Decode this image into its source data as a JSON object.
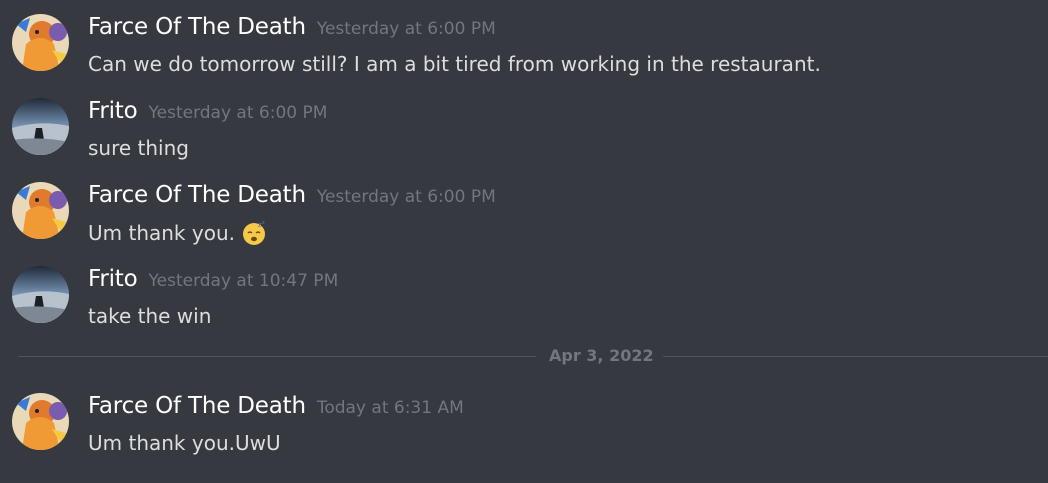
{
  "messages": [
    {
      "author": "Farce Of The Death",
      "timestamp": "Yesterday at 6:00 PM",
      "text": "Can we do tomorrow still? I am a bit tired from working in the restaurant."
    },
    {
      "author": "Frito",
      "timestamp": "Yesterday at 6:00 PM",
      "text": "sure thing"
    },
    {
      "author": "Farce Of The Death",
      "timestamp": "Yesterday at 6:00 PM",
      "text": "Um thank you.",
      "emoji": "sleepy-face-emoji"
    },
    {
      "author": "Frito",
      "timestamp": "Yesterday at 10:47 PM",
      "text": "take the win"
    },
    {
      "author": "Farce Of The Death",
      "timestamp": "Today at 6:31 AM",
      "text": "Um thank you.UwU"
    }
  ],
  "date_divider": "Apr 3, 2022",
  "colors": {
    "background": "#36393f",
    "username": "#ffffff",
    "message_text": "#dcddde",
    "muted": "#72767d",
    "divider": "#4f545c"
  }
}
